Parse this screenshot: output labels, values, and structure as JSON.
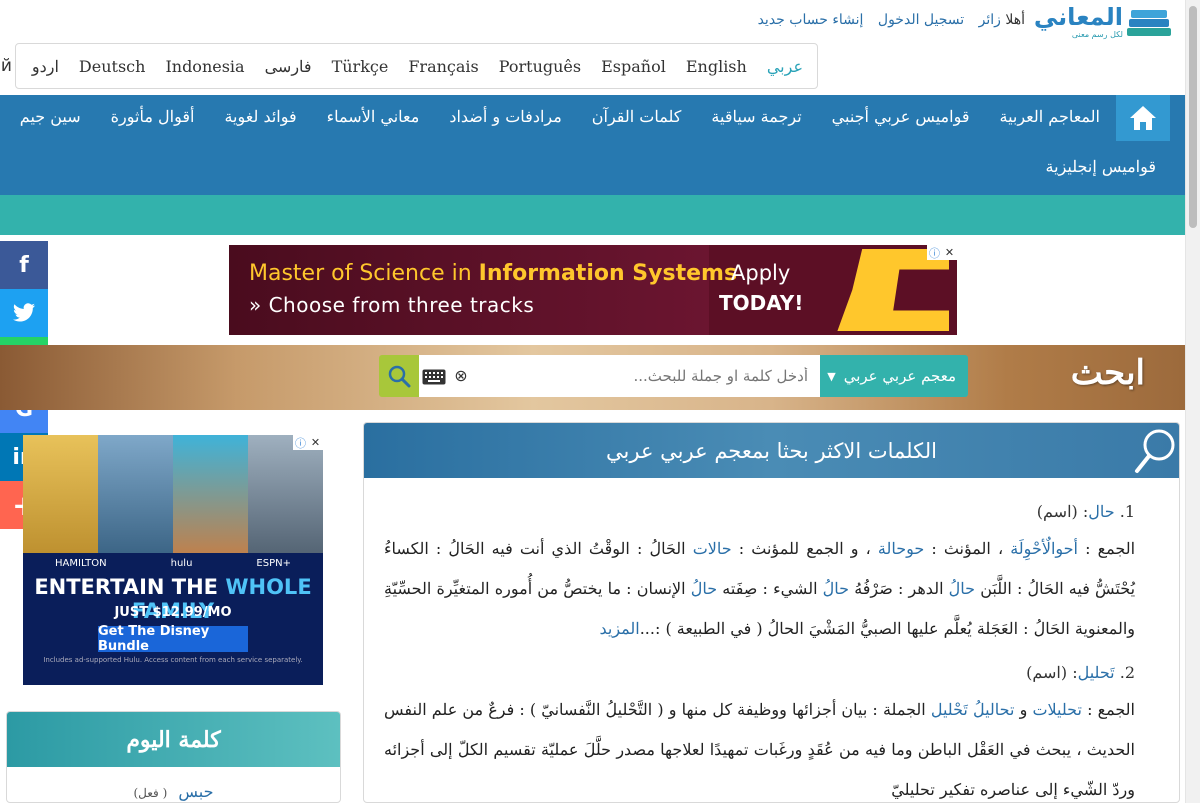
{
  "header": {
    "logo_text": "المعاني",
    "logo_tagline": "لكل رسم معنى",
    "greeting": "أهلا",
    "visitor": "زائر",
    "login": "تسجيل الدخول",
    "register": "إنشاء حساب جديد"
  },
  "languages": [
    "عربي",
    "English",
    "Español",
    "Português",
    "Français",
    "Türkçe",
    "فارسی",
    "Indonesia",
    "Deutsch",
    "اردو",
    "Русский"
  ],
  "nav": {
    "row1": [
      "المعاجم العربية",
      "قواميس عربي أجنبي",
      "ترجمة سياقية",
      "كلمات القرآن",
      "مرادفات و أضداد",
      "معاني الأسماء",
      "فوائد لغوية",
      "أقوال مأثورة",
      "سين جيم"
    ],
    "row2": [
      "قواميس إنجليزية"
    ]
  },
  "ad_top": {
    "line1_prefix": "Master of Science in ",
    "line1_bold": "Information Systems",
    "line2": "» Choose from three tracks",
    "cta1": "Apply",
    "cta2": "TODAY!"
  },
  "search": {
    "title": "ابحث",
    "dictionary": "معجم عربي عربي",
    "placeholder": "أدخل كلمة او جملة للبحث..."
  },
  "ad_side": {
    "brands": [
      "HAMILTON",
      "hulu",
      "ESPN+"
    ],
    "headline_a": "ENTERTAIN THE ",
    "headline_b": "WHOLE FAMILY",
    "price": "JUST $12.99/MO",
    "cta": "Get The Disney Bundle",
    "fine": "Includes ad-supported Hulu. Access content from each service separately."
  },
  "word_of_day": {
    "title": "كلمة اليوم",
    "word": "حبس",
    "type": "( فعل)"
  },
  "panel": {
    "title": "الكلمات الاكثر بحثا بمعجم عربي عربي",
    "entries": [
      {
        "num": "1.",
        "word": "حال",
        "type": ": (اسم)",
        "b1": "الجمع : ",
        "l1": "أحوالٌ",
        "l2": "أحْوِلَة",
        "b2": " ، المؤنث : ",
        "l3": "حوحالة",
        "b3": " ، و الجمع للمؤنث : ",
        "l4": "حالات",
        "b4": " الحَالُ : الوقْتُ الذي أنت فيه الحَالُ : الكساءُ يُحْتَشُّ فيه الحَالُ : اللَّبَن ",
        "l5": "حالُ",
        "b5": " الدهر : صَرْفُهُ ",
        "l6": "حالُ",
        "b6": " الشيء : صِفَته ",
        "l7": "حالُ",
        "b7": " الإنسان : ما يختصُّ من أُموره المتغيِّرة الحسِّيّةِ والمعنوية الحَالُ : العَجَلة يُعلَّم عليها الصبيُّ المَشْيَ الحالُ ( في الطبيعة ) :...",
        "more": "المزيد"
      },
      {
        "num": "2.",
        "word": "تَحليل",
        "type": ": (اسم)",
        "b1": "الجمع : ",
        "l1": "تحليلات",
        "b2": " و ",
        "l2": "تحاليلُ",
        "b3": " ",
        "l3": "تَحْليل",
        "b4": " الجملة : بيان أجزائها ووظيفة كل منها و ( التَّحْليلُ النَّفسانيّ ) : فرعٌ من علم النفس الحديث ، يبحث في العَقْل الباطن وما فيه من عُقَدٍ ورغَبات تمهيدًا لعلاجها مصدر حلَّلَ عمليّة تقسيم الكلّ إلى أجزائه وردّ الشّيء إلى عناصره تفكير تحليليّ"
      }
    ]
  },
  "colors": {
    "nav": "#2779b0",
    "teal": "#33b2ac",
    "link": "#2a6fa8",
    "search_btn": "#a8c73a"
  }
}
